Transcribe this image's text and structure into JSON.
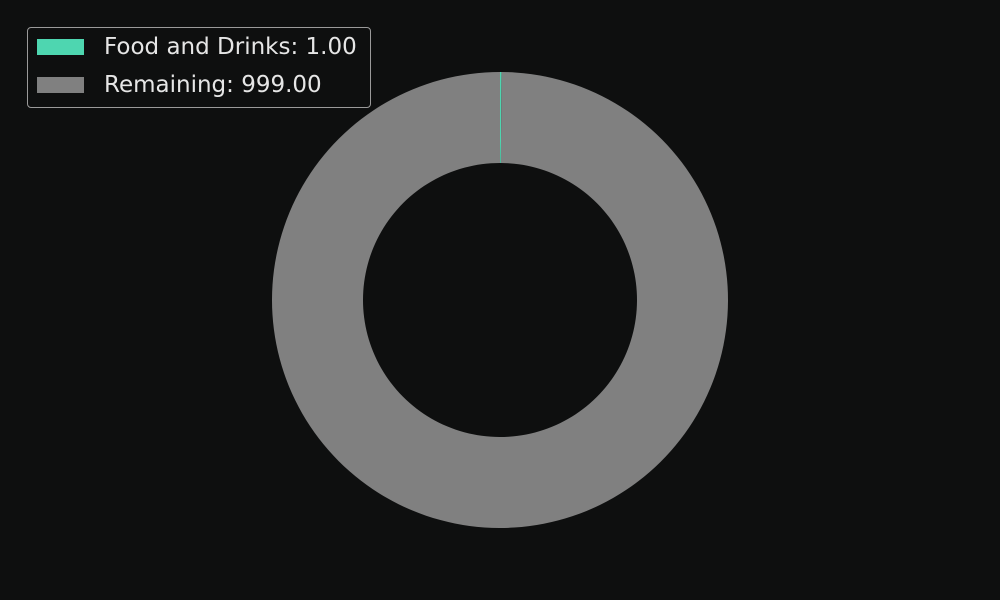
{
  "chart_data": {
    "type": "pie",
    "donut": true,
    "start_angle": "top",
    "direction": "clockwise",
    "categories": [
      "Food and Drinks",
      "Remaining"
    ],
    "values": [
      1.0,
      999.0
    ],
    "colors": [
      "#4ed6b0",
      "#808080"
    ],
    "legend": {
      "placement": "top-left",
      "entries": [
        {
          "label": "Food and Drinks: 1.00",
          "color": "#4ed6b0"
        },
        {
          "label": "Remaining: 999.00",
          "color": "#808080"
        }
      ]
    }
  },
  "theme": {
    "background": "#0e0f0f",
    "text": "#e6e6e6",
    "legend_border": "#9a9a9a"
  }
}
